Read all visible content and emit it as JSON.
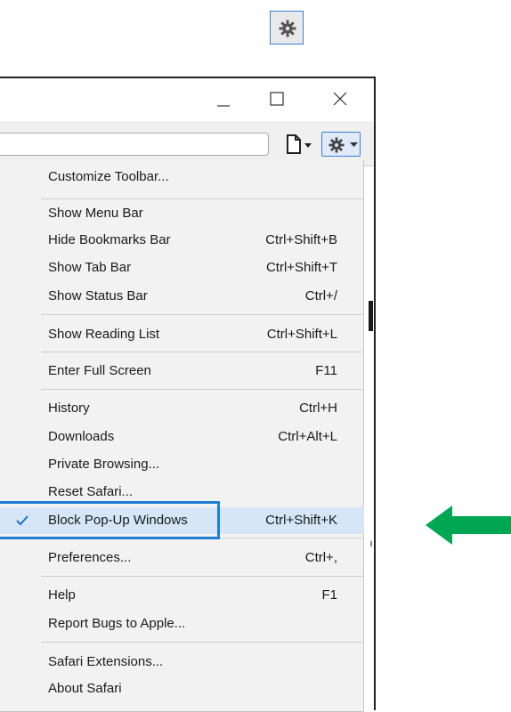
{
  "colors": {
    "accent": "#1e7fd3",
    "arrow": "#00a651",
    "menu_bg": "#f2f2f2",
    "checked_bg": "#d6e6f7"
  },
  "icons": {
    "top_gear": "gear-icon",
    "minimize": "minimize-icon",
    "maximize": "maximize-icon",
    "close": "close-icon",
    "page_menu": "page-icon",
    "settings_menu": "gear-icon",
    "check": "checkmark-icon",
    "pointer": "arrow-left-icon"
  },
  "menu": {
    "items": [
      {
        "label": "Customize Toolbar...",
        "shortcut": ""
      },
      {
        "label": "Show Menu Bar",
        "shortcut": ""
      },
      {
        "label": "Hide Bookmarks Bar",
        "shortcut": "Ctrl+Shift+B"
      },
      {
        "label": "Show Tab Bar",
        "shortcut": "Ctrl+Shift+T"
      },
      {
        "label": "Show Status Bar",
        "shortcut": "Ctrl+/"
      },
      {
        "label": "Show Reading List",
        "shortcut": "Ctrl+Shift+L"
      },
      {
        "label": "Enter Full Screen",
        "shortcut": "F11"
      },
      {
        "label": "History",
        "shortcut": "Ctrl+H"
      },
      {
        "label": "Downloads",
        "shortcut": "Ctrl+Alt+L"
      },
      {
        "label": "Private Browsing...",
        "shortcut": ""
      },
      {
        "label": "Reset Safari...",
        "shortcut": ""
      },
      {
        "label": "Block Pop-Up Windows",
        "shortcut": "Ctrl+Shift+K",
        "checked": true
      },
      {
        "label": "Preferences...",
        "shortcut": "Ctrl+,"
      },
      {
        "label": "Help",
        "shortcut": "F1"
      },
      {
        "label": "Report Bugs to Apple...",
        "shortcut": ""
      },
      {
        "label": "Safari Extensions...",
        "shortcut": ""
      },
      {
        "label": "About Safari",
        "shortcut": ""
      }
    ]
  }
}
